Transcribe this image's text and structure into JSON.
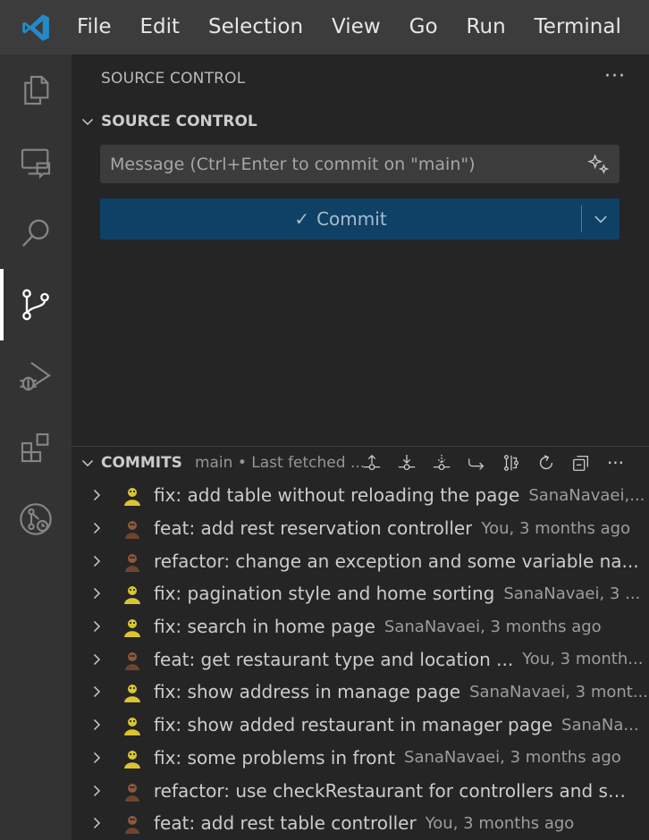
{
  "menu": [
    "File",
    "Edit",
    "Selection",
    "View",
    "Go",
    "Run",
    "Terminal"
  ],
  "colors": {
    "titlebar": "#3c3c3c",
    "activitybar": "#333333",
    "sidebar": "#252526",
    "commit_button": "#0e4165",
    "vscode_blue": "#2489ca"
  },
  "activity_icons": [
    "explorer-icon",
    "remote-explorer-icon",
    "search-icon",
    "source-control-icon",
    "run-debug-icon",
    "extensions-icon",
    "git-history-icon"
  ],
  "sidebar": {
    "title": "SOURCE CONTROL",
    "more": "···",
    "scm": {
      "header": "SOURCE CONTROL",
      "message_placeholder": "Message (Ctrl+Enter to commit on \"main\")",
      "message_value": "",
      "commit_check": "✓",
      "commit_label": "Commit"
    },
    "commits": {
      "header": "COMMITS",
      "description": "main • Last fetched ...",
      "more": "···",
      "items": [
        {
          "message": "fix: add table without reloading the page",
          "meta": "SanaNavaei,...",
          "avatar": "yellow"
        },
        {
          "message": "feat: add rest reservation controller",
          "meta": "You, 3 months ago",
          "avatar": "brown"
        },
        {
          "message": "refactor: change an exception and some variable na...",
          "meta": "",
          "avatar": "brown"
        },
        {
          "message": "fix: pagination style and home sorting",
          "meta": "SanaNavaei, 3 ...",
          "avatar": "yellow"
        },
        {
          "message": "fix: search in home page",
          "meta": "SanaNavaei, 3 months ago",
          "avatar": "yellow"
        },
        {
          "message": "feat: get restaurant type and location ...",
          "meta": "You, 3 month...",
          "avatar": "brown"
        },
        {
          "message": "fix: show address in manage page",
          "meta": "SanaNavaei, 3 mont...",
          "avatar": "yellow"
        },
        {
          "message": "fix: show added restaurant in manager page",
          "meta": "SanaNa...",
          "avatar": "yellow"
        },
        {
          "message": "fix: some problems in front",
          "meta": "SanaNavaei, 3 months ago",
          "avatar": "yellow"
        },
        {
          "message": "refactor: use checkRestaurant for controllers and sm...",
          "meta": "",
          "avatar": "brown"
        },
        {
          "message": "feat: add rest table controller",
          "meta": "You, 3 months ago",
          "avatar": "brown"
        }
      ]
    }
  }
}
